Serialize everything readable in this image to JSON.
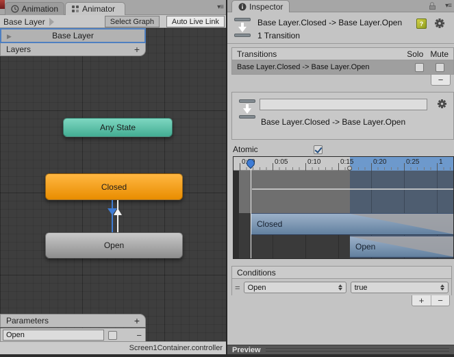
{
  "left_pane": {
    "tabs": {
      "animation": "Animation",
      "animator": "Animator"
    },
    "toolbar": {
      "breadcrumb": "Base Layer",
      "select_graph": "Select Graph",
      "auto_live_link": "Auto Live Link"
    },
    "layer_item": {
      "name": "Base Layer"
    },
    "layers_bar": {
      "label": "Layers"
    },
    "nodes": {
      "any_state": "Any State",
      "closed": "Closed",
      "open": "Open"
    },
    "parameters": {
      "header": "Parameters",
      "param_value": "Open"
    },
    "status": "Screen1Container.controller"
  },
  "inspector": {
    "tab": "Inspector",
    "header": {
      "title": "Base Layer.Closed -> Base Layer.Open",
      "subtitle": "1 Transition"
    },
    "transitions": {
      "header": "Transitions",
      "solo": "Solo",
      "mute": "Mute",
      "row": {
        "label": "Base Layer.Closed -> Base Layer.Open"
      }
    },
    "detail": {
      "name_value": "",
      "label": "Base Layer.Closed -> Base Layer.Open"
    },
    "atomic": {
      "label": "Atomic"
    },
    "timeline": {
      "ticks": [
        "0:00",
        "0:05",
        "0:10",
        "0:15",
        "0:20",
        "0:25",
        "1"
      ],
      "tracks": {
        "closed": "Closed",
        "open": "Open"
      }
    },
    "conditions": {
      "header": "Conditions",
      "parameter": "Open",
      "value": "true"
    },
    "preview": {
      "label": "Preview"
    }
  },
  "icons": {
    "plus": "+",
    "minus": "−",
    "pane_menu": "▾≡",
    "layer_triangle": "▶",
    "drag_handle": "=",
    "help": "?"
  }
}
